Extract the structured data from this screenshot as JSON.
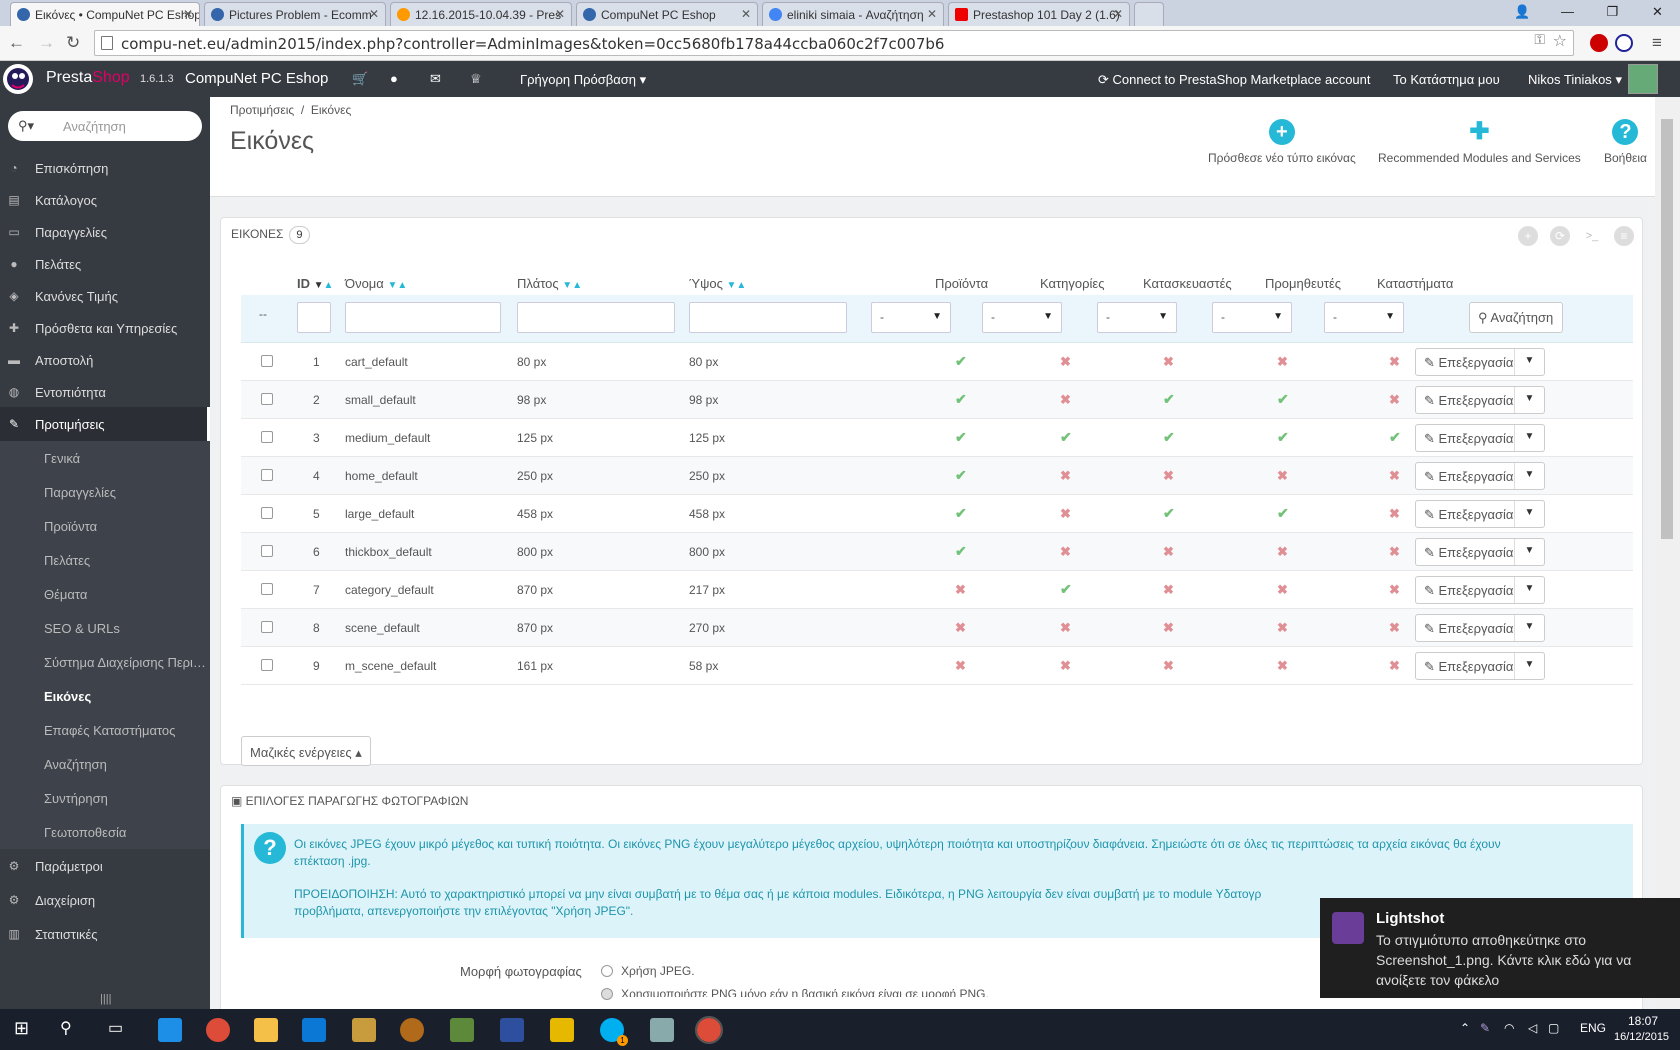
{
  "browser": {
    "tabs": [
      {
        "title": "Εικόνες • CompuNet PC Eshop",
        "active": true
      },
      {
        "title": "Pictures Problem - Ecomm"
      },
      {
        "title": "12.16.2015-10.04.39 - Pres"
      },
      {
        "title": "CompuNet PC Eshop"
      },
      {
        "title": "eliniki simaia - Αναζήτηση"
      },
      {
        "title": "Prestashop 101 Day 2 (1.6)"
      }
    ],
    "url": "compu-net.eu/admin2015/index.php?controller=AdminImages&token=0cc5680fb178a44ccba060c2f7c007b6"
  },
  "header": {
    "brand_a": "Presta",
    "brand_b": "Shop",
    "version": "1.6.1.3",
    "shop_name": "CompuNet PC Eshop",
    "quick_access": "Γρήγορη Πρόσβαση",
    "marketplace": "Connect to PrestaShop Marketplace account",
    "my_shop": "Το Κατάστημα μου",
    "user": "Nikos Tiniakos"
  },
  "sidebar": {
    "search_placeholder": "Αναζήτηση",
    "items": [
      {
        "label": "Επισκόπηση",
        "icon": "dashboard-icon"
      },
      {
        "label": "Κατάλογος",
        "icon": "book-icon"
      },
      {
        "label": "Παραγγελίες",
        "icon": "credit-card-icon"
      },
      {
        "label": "Πελάτες",
        "icon": "users-icon"
      },
      {
        "label": "Κανόνες Τιμής",
        "icon": "tag-icon"
      },
      {
        "label": "Πρόσθετα και Υπηρεσίες",
        "icon": "puzzle-icon"
      },
      {
        "label": "Αποστολή",
        "icon": "truck-icon"
      },
      {
        "label": "Εντοπιότητα",
        "icon": "globe-icon"
      },
      {
        "label": "Προτιμήσεις",
        "icon": "wrench-icon",
        "active": true
      }
    ],
    "sub_items": [
      "Γενικά",
      "Παραγγελίες",
      "Προϊόντα",
      "Πελάτες",
      "Θέματα",
      "SEO & URLs",
      "Σύστημα Διαχείρισης Περιεχομένου",
      "Εικόνες",
      "Επαφές Καταστήματος",
      "Αναζήτηση",
      "Συντήρηση",
      "Γεωτοποθεσία"
    ],
    "bottom_items": [
      {
        "label": "Παράμετροι",
        "icon": "cogs-icon"
      },
      {
        "label": "Διαχείριση",
        "icon": "cog-icon"
      },
      {
        "label": "Στατιστικές",
        "icon": "bar-chart-icon"
      }
    ]
  },
  "page": {
    "breadcrumb_1": "Προτιμήσεις",
    "breadcrumb_sep": "/",
    "breadcrumb_2": "Εικόνες",
    "title": "Εικόνες",
    "toolbar": {
      "add": "Πρόσθεσε νέο τύπο εικόνας",
      "modules": "Recommended Modules and Services",
      "help": "Βοήθεια"
    }
  },
  "list": {
    "heading": "ΕΙΚΟΝΕΣ",
    "count": "9",
    "columns": [
      "ID",
      "Όνομα",
      "Πλάτος",
      "Ύψος",
      "Προϊόντα",
      "Κατηγορίες",
      "Κατασκευαστές",
      "Προμηθευτές",
      "Καταστήματα"
    ],
    "filter_dash": "--",
    "select_value": "-",
    "search_button": "Αναζήτηση",
    "edit_label": "Επεξεργασία",
    "bulk_label": "Μαζικές ενέργειες",
    "rows": [
      {
        "id": "1",
        "name": "cart_default",
        "width": "80 px",
        "height": "80 px",
        "flags": [
          1,
          0,
          0,
          0,
          0
        ]
      },
      {
        "id": "2",
        "name": "small_default",
        "width": "98 px",
        "height": "98 px",
        "flags": [
          1,
          0,
          1,
          1,
          0
        ]
      },
      {
        "id": "3",
        "name": "medium_default",
        "width": "125 px",
        "height": "125 px",
        "flags": [
          1,
          1,
          1,
          1,
          1
        ]
      },
      {
        "id": "4",
        "name": "home_default",
        "width": "250 px",
        "height": "250 px",
        "flags": [
          1,
          0,
          0,
          0,
          0
        ]
      },
      {
        "id": "5",
        "name": "large_default",
        "width": "458 px",
        "height": "458 px",
        "flags": [
          1,
          0,
          1,
          1,
          0
        ]
      },
      {
        "id": "6",
        "name": "thickbox_default",
        "width": "800 px",
        "height": "800 px",
        "flags": [
          1,
          0,
          0,
          0,
          0
        ]
      },
      {
        "id": "7",
        "name": "category_default",
        "width": "870 px",
        "height": "217 px",
        "flags": [
          0,
          1,
          0,
          0,
          0
        ]
      },
      {
        "id": "8",
        "name": "scene_default",
        "width": "870 px",
        "height": "270 px",
        "flags": [
          0,
          0,
          0,
          0,
          0
        ]
      },
      {
        "id": "9",
        "name": "m_scene_default",
        "width": "161 px",
        "height": "58 px",
        "flags": [
          0,
          0,
          0,
          0,
          0
        ]
      }
    ]
  },
  "options": {
    "heading": "ΕΠΙΛΟΓΕΣ ΠΑΡΑΓΩΓΗΣ ΦΩΤΟΓΡΑΦΙΩΝ",
    "info_1": "Οι εικόνες JPEG έχουν μικρό μέγεθος και τυπική ποιότητα. Οι εικόνες PNG έχουν μεγαλύτερο μέγεθος αρχείου, υψηλότερη ποιότητα και υποστηρίζουν διαφάνεια. Σημειώστε ότι σε όλες τις περιπτώσεις τα αρχεία εικόνας θα έχουν",
    "info_1b": "επέκταση .jpg.",
    "info_2": "ΠΡΟΕΙΔΟΠΟΙΗΣΗ: Αυτό το χαρακτηριστικό μπορεί να μην είναι συμβατή με το θέμα σας ή με κάποια modules. Ειδικότερα, η PNG λειτουργία δεν είναι συμβατή με το module Υδατογρ",
    "info_2b": "προβλήματα, απενεργοποιήστε την επιλέγοντας \"Χρήση JPEG\".",
    "format_label": "Μορφή φωτογραφίας",
    "radio_1": "Χρήση JPEG.",
    "radio_2": "Χρησιμοποιήστε PNG μόνο εάν η βασική εικόνα είναι σε μορφή PNG."
  },
  "toast": {
    "title": "Lightshot",
    "message": "Το στιγμιότυπο αποθηκεύτηκε στο Screenshot_1.png. Κάντε κλικ εδώ για να ανοίξετε τον φάκελο"
  },
  "taskbar": {
    "lang": "ENG",
    "time": "18:07",
    "date": "16/12/2015",
    "skype_badge": "1"
  },
  "colors": {
    "accent": "#25b9d7",
    "header": "#363a41",
    "ok": "#72c279",
    "no": "#e08f95"
  }
}
